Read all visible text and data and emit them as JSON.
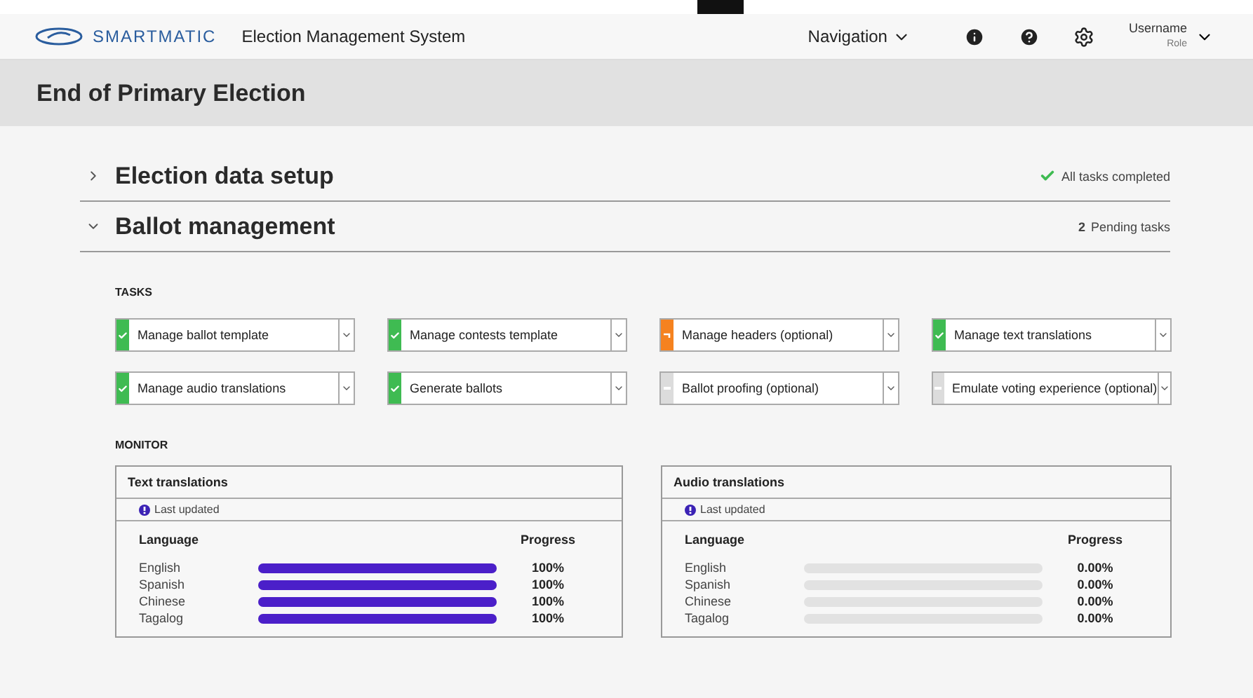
{
  "header": {
    "logo": "SMARTMATIC",
    "app_title": "Election Management System",
    "navigation": "Navigation",
    "user": {
      "name": "Username",
      "role": "Role"
    }
  },
  "page_title": "End of Primary Election",
  "sections": [
    {
      "title": "Election data setup",
      "expanded": false,
      "status": "All tasks completed",
      "kind": "complete"
    },
    {
      "title": "Ballot management",
      "expanded": true,
      "status_count": "2",
      "status": "Pending tasks",
      "kind": "pending"
    }
  ],
  "tasks_label": "TASKS",
  "tasks": [
    {
      "label": "Manage ballot template",
      "kind": "done"
    },
    {
      "label": "Manage contests template",
      "kind": "done"
    },
    {
      "label": "Manage headers (optional)",
      "kind": "active"
    },
    {
      "label": "Manage text translations",
      "kind": "done"
    },
    {
      "label": "Manage audio translations",
      "kind": "done"
    },
    {
      "label": "Generate ballots",
      "kind": "done"
    },
    {
      "label": "Ballot proofing (optional)",
      "kind": "pending"
    },
    {
      "label": "Emulate voting experience (optional)",
      "kind": "pending"
    }
  ],
  "monitor_label": "MONITOR",
  "monitors": [
    {
      "title": "Text translations",
      "updated": "Last updated",
      "language_header": "Language",
      "progress_header": "Progress",
      "rows": [
        {
          "language": "English",
          "level": 1,
          "reading": "100%"
        },
        {
          "language": "Spanish",
          "level": 1,
          "reading": "100%"
        },
        {
          "language": "Chinese",
          "level": 1,
          "reading": "100%"
        },
        {
          "language": "Tagalog",
          "level": 1,
          "reading": "100%"
        }
      ]
    },
    {
      "title": "Audio translations",
      "updated": "Last updated",
      "language_header": "Language",
      "progress_header": "Progress",
      "rows": [
        {
          "language": "English",
          "level": 0,
          "reading": "0.00%"
        },
        {
          "language": "Spanish",
          "level": 0,
          "reading": "0.00%"
        },
        {
          "language": "Chinese",
          "level": 0,
          "reading": "0.00%"
        },
        {
          "language": "Tagalog",
          "level": 0,
          "reading": "0.00%"
        }
      ]
    }
  ]
}
